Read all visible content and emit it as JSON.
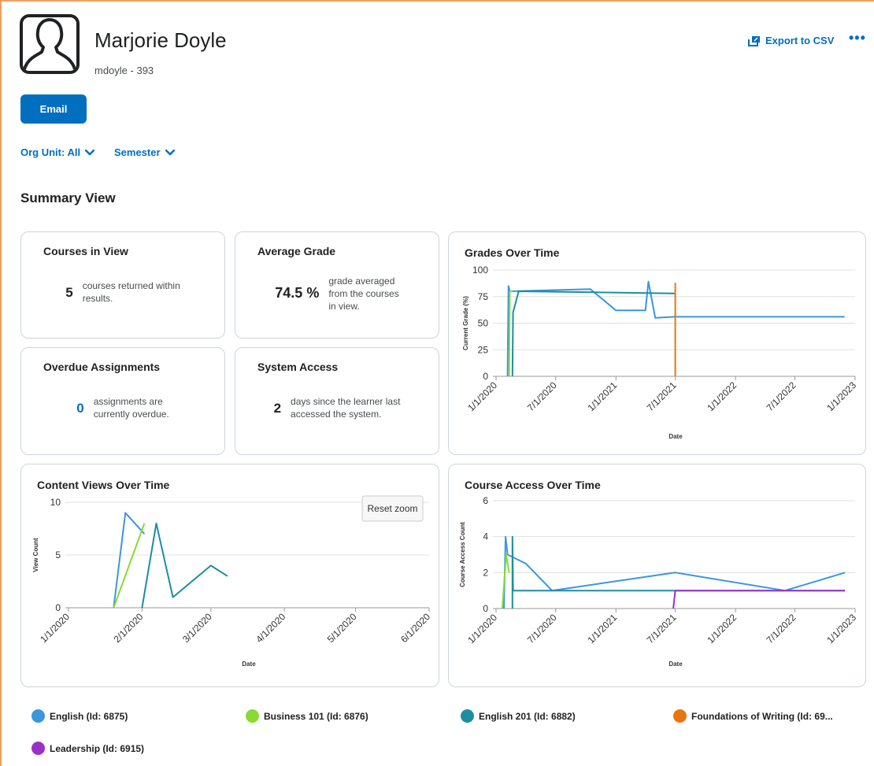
{
  "user": {
    "name": "Marjorie Doyle",
    "username": "mdoyle - 393"
  },
  "header": {
    "export_label": "Export to CSV",
    "more_label": "•••"
  },
  "actions": {
    "email_label": "Email"
  },
  "filters": {
    "org_unit": "Org Unit: All",
    "semester": "Semester"
  },
  "summary": {
    "title": "Summary View",
    "cards": [
      {
        "title": "Courses in View",
        "value": "5",
        "desc": [
          "courses returned within",
          "results."
        ]
      },
      {
        "title": "Average Grade",
        "value": "74.5 %",
        "desc": [
          "grade averaged",
          "from the courses",
          "in view."
        ]
      },
      {
        "title": "Overdue Assignments",
        "value": "0",
        "desc": [
          "assignments are",
          "currently overdue."
        ]
      },
      {
        "title": "System Access",
        "value": "2",
        "desc": [
          "days since the learner last",
          "accessed the system."
        ]
      }
    ]
  },
  "colors": {
    "accent": "#006fbf",
    "English": "#3a96dd",
    "Business101": "#8ad934",
    "English201": "#1c8ea0",
    "Foundations": "#e87511",
    "Leadership": "#9b30c9"
  },
  "legend": [
    {
      "label": "English (Id: 6875)",
      "color": "#3a96dd"
    },
    {
      "label": "Business 101 (Id: 6876)",
      "color": "#8ad934"
    },
    {
      "label": "English 201 (Id: 6882)",
      "color": "#1c8ea0"
    },
    {
      "label": "Foundations of Writing (Id: 69...",
      "color": "#e87511"
    },
    {
      "label": "Leadership (Id: 6915)",
      "color": "#9b30c9"
    }
  ],
  "chart_data": [
    {
      "type": "line",
      "title": "Grades Over Time",
      "xlabel": "Date",
      "ylabel": "Current Grade (%)",
      "ylim": [
        0,
        100
      ],
      "y_ticks": [
        "0",
        "25",
        "50",
        "75",
        "100"
      ],
      "x_ticks": [
        "1/1/2020",
        "7/1/2020",
        "1/1/2021",
        "7/1/2021",
        "1/1/2022",
        "7/1/2022",
        "1/1/2023"
      ],
      "grid": true,
      "series": [
        {
          "name": "English (Id: 6875)",
          "points": [
            [
              "2020-02-05",
              0
            ],
            [
              "2020-02-08",
              85
            ],
            [
              "2020-02-12",
              80
            ],
            [
              "2020-10-15",
              82
            ],
            [
              "2021-01-01",
              62
            ],
            [
              "2021-04-01",
              62
            ],
            [
              "2021-04-10",
              89
            ],
            [
              "2021-05-01",
              55
            ],
            [
              "2021-07-01",
              56
            ],
            [
              "2022-11-30",
              56
            ]
          ]
        },
        {
          "name": "Business 101 (Id: 6876)",
          "points": [
            [
              "2020-02-10",
              0
            ],
            [
              "2020-02-12",
              80
            ],
            [
              "2020-02-20",
              80
            ]
          ]
        },
        {
          "name": "English 201 (Id: 6882)",
          "points": [
            [
              "2020-02-20",
              0
            ],
            [
              "2020-02-22",
              60
            ],
            [
              "2020-03-10",
              80
            ],
            [
              "2021-07-01",
              78
            ]
          ]
        },
        {
          "name": "Foundations of Writing (Id: 69...",
          "points": [
            [
              "2021-07-01",
              0
            ],
            [
              "2021-07-01",
              88
            ]
          ]
        }
      ]
    },
    {
      "type": "line",
      "title": "Content Views Over Time",
      "xlabel": "Date",
      "ylabel": "View Count",
      "ylim": [
        0,
        10
      ],
      "y_ticks": [
        "0",
        "5",
        "10"
      ],
      "x_ticks": [
        "1/1/2020",
        "2/1/2020",
        "3/1/2020",
        "4/1/2020",
        "5/1/2020",
        "6/1/2020"
      ],
      "grid": true,
      "reset_zoom_label": "Reset zoom",
      "series": [
        {
          "name": "English (Id: 6875)",
          "points": [
            [
              "2020-01-20",
              0
            ],
            [
              "2020-01-25",
              9
            ],
            [
              "2020-02-02",
              7
            ]
          ]
        },
        {
          "name": "Business 101 (Id: 6876)",
          "points": [
            [
              "2020-01-20",
              0
            ],
            [
              "2020-02-02",
              8
            ]
          ]
        },
        {
          "name": "English 201 (Id: 6882)",
          "points": [
            [
              "2020-02-01",
              0
            ],
            [
              "2020-02-07",
              8
            ],
            [
              "2020-02-14",
              1
            ],
            [
              "2020-03-01",
              4
            ],
            [
              "2020-03-08",
              3
            ]
          ]
        }
      ]
    },
    {
      "type": "line",
      "title": "Course Access Over Time",
      "xlabel": "Date",
      "ylabel": "Course Access Count",
      "ylim": [
        0,
        6
      ],
      "y_ticks": [
        "0",
        "2",
        "4",
        "6"
      ],
      "x_ticks": [
        "1/1/2020",
        "7/1/2020",
        "1/1/2021",
        "7/1/2021",
        "1/1/2022",
        "7/1/2022",
        "1/1/2023"
      ],
      "grid": true,
      "series": [
        {
          "name": "English (Id: 6875)",
          "points": [
            [
              "2020-01-25",
              0
            ],
            [
              "2020-01-30",
              4
            ],
            [
              "2020-02-05",
              3
            ],
            [
              "2020-04-01",
              2.5
            ],
            [
              "2020-06-20",
              1
            ],
            [
              "2021-07-01",
              2
            ],
            [
              "2022-06-01",
              1
            ],
            [
              "2022-12-01",
              2
            ]
          ]
        },
        {
          "name": "Business 101 (Id: 6876)",
          "points": [
            [
              "2020-01-20",
              0
            ],
            [
              "2020-02-01",
              3
            ],
            [
              "2020-02-10",
              2
            ]
          ]
        },
        {
          "name": "English 201 (Id: 6882)",
          "points": [
            [
              "2020-02-20",
              0
            ],
            [
              "2020-02-20",
              4
            ],
            [
              "2020-02-22",
              1
            ],
            [
              "2022-12-01",
              1
            ]
          ]
        },
        {
          "name": "Leadership (Id: 6915)",
          "points": [
            [
              "2021-06-25",
              0
            ],
            [
              "2021-07-01",
              1
            ],
            [
              "2022-12-01",
              1
            ]
          ]
        }
      ]
    }
  ]
}
